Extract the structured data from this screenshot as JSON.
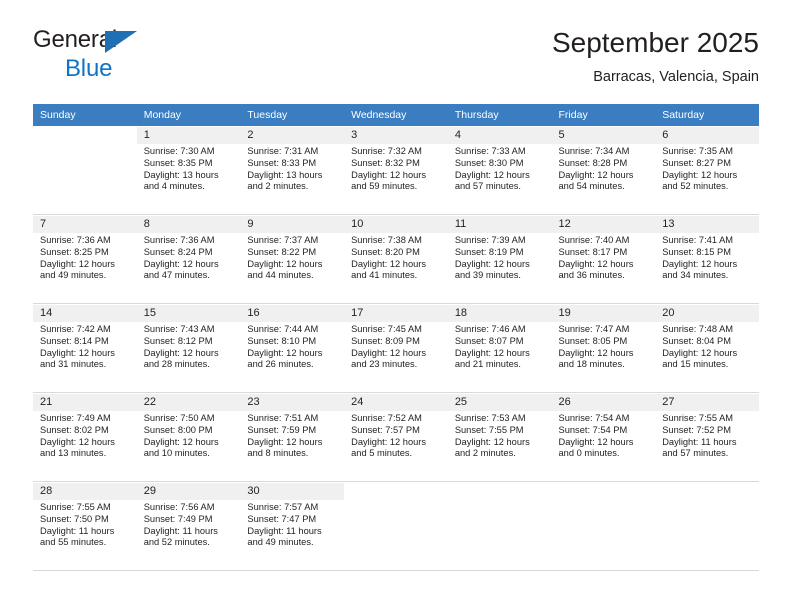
{
  "brand": {
    "name_part1": "General",
    "name_part2": "Blue",
    "triangle_icon": "triangle-icon"
  },
  "header": {
    "title": "September 2025",
    "subtitle": "Barracas, Valencia, Spain"
  },
  "colors": {
    "header_band": "#3a7dc0",
    "brand_blue": "#1273c4",
    "daynum_bg": "#f0f0f0",
    "grid_line": "#d9d9d9",
    "text": "#231f20"
  },
  "weekday_headers": [
    "Sunday",
    "Monday",
    "Tuesday",
    "Wednesday",
    "Thursday",
    "Friday",
    "Saturday"
  ],
  "weeks": [
    [
      {
        "day": "",
        "lines": []
      },
      {
        "day": "1",
        "lines": [
          "Sunrise: 7:30 AM",
          "Sunset: 8:35 PM",
          "Daylight: 13 hours",
          "and 4 minutes."
        ]
      },
      {
        "day": "2",
        "lines": [
          "Sunrise: 7:31 AM",
          "Sunset: 8:33 PM",
          "Daylight: 13 hours",
          "and 2 minutes."
        ]
      },
      {
        "day": "3",
        "lines": [
          "Sunrise: 7:32 AM",
          "Sunset: 8:32 PM",
          "Daylight: 12 hours",
          "and 59 minutes."
        ]
      },
      {
        "day": "4",
        "lines": [
          "Sunrise: 7:33 AM",
          "Sunset: 8:30 PM",
          "Daylight: 12 hours",
          "and 57 minutes."
        ]
      },
      {
        "day": "5",
        "lines": [
          "Sunrise: 7:34 AM",
          "Sunset: 8:28 PM",
          "Daylight: 12 hours",
          "and 54 minutes."
        ]
      },
      {
        "day": "6",
        "lines": [
          "Sunrise: 7:35 AM",
          "Sunset: 8:27 PM",
          "Daylight: 12 hours",
          "and 52 minutes."
        ]
      }
    ],
    [
      {
        "day": "7",
        "lines": [
          "Sunrise: 7:36 AM",
          "Sunset: 8:25 PM",
          "Daylight: 12 hours",
          "and 49 minutes."
        ]
      },
      {
        "day": "8",
        "lines": [
          "Sunrise: 7:36 AM",
          "Sunset: 8:24 PM",
          "Daylight: 12 hours",
          "and 47 minutes."
        ]
      },
      {
        "day": "9",
        "lines": [
          "Sunrise: 7:37 AM",
          "Sunset: 8:22 PM",
          "Daylight: 12 hours",
          "and 44 minutes."
        ]
      },
      {
        "day": "10",
        "lines": [
          "Sunrise: 7:38 AM",
          "Sunset: 8:20 PM",
          "Daylight: 12 hours",
          "and 41 minutes."
        ]
      },
      {
        "day": "11",
        "lines": [
          "Sunrise: 7:39 AM",
          "Sunset: 8:19 PM",
          "Daylight: 12 hours",
          "and 39 minutes."
        ]
      },
      {
        "day": "12",
        "lines": [
          "Sunrise: 7:40 AM",
          "Sunset: 8:17 PM",
          "Daylight: 12 hours",
          "and 36 minutes."
        ]
      },
      {
        "day": "13",
        "lines": [
          "Sunrise: 7:41 AM",
          "Sunset: 8:15 PM",
          "Daylight: 12 hours",
          "and 34 minutes."
        ]
      }
    ],
    [
      {
        "day": "14",
        "lines": [
          "Sunrise: 7:42 AM",
          "Sunset: 8:14 PM",
          "Daylight: 12 hours",
          "and 31 minutes."
        ]
      },
      {
        "day": "15",
        "lines": [
          "Sunrise: 7:43 AM",
          "Sunset: 8:12 PM",
          "Daylight: 12 hours",
          "and 28 minutes."
        ]
      },
      {
        "day": "16",
        "lines": [
          "Sunrise: 7:44 AM",
          "Sunset: 8:10 PM",
          "Daylight: 12 hours",
          "and 26 minutes."
        ]
      },
      {
        "day": "17",
        "lines": [
          "Sunrise: 7:45 AM",
          "Sunset: 8:09 PM",
          "Daylight: 12 hours",
          "and 23 minutes."
        ]
      },
      {
        "day": "18",
        "lines": [
          "Sunrise: 7:46 AM",
          "Sunset: 8:07 PM",
          "Daylight: 12 hours",
          "and 21 minutes."
        ]
      },
      {
        "day": "19",
        "lines": [
          "Sunrise: 7:47 AM",
          "Sunset: 8:05 PM",
          "Daylight: 12 hours",
          "and 18 minutes."
        ]
      },
      {
        "day": "20",
        "lines": [
          "Sunrise: 7:48 AM",
          "Sunset: 8:04 PM",
          "Daylight: 12 hours",
          "and 15 minutes."
        ]
      }
    ],
    [
      {
        "day": "21",
        "lines": [
          "Sunrise: 7:49 AM",
          "Sunset: 8:02 PM",
          "Daylight: 12 hours",
          "and 13 minutes."
        ]
      },
      {
        "day": "22",
        "lines": [
          "Sunrise: 7:50 AM",
          "Sunset: 8:00 PM",
          "Daylight: 12 hours",
          "and 10 minutes."
        ]
      },
      {
        "day": "23",
        "lines": [
          "Sunrise: 7:51 AM",
          "Sunset: 7:59 PM",
          "Daylight: 12 hours",
          "and 8 minutes."
        ]
      },
      {
        "day": "24",
        "lines": [
          "Sunrise: 7:52 AM",
          "Sunset: 7:57 PM",
          "Daylight: 12 hours",
          "and 5 minutes."
        ]
      },
      {
        "day": "25",
        "lines": [
          "Sunrise: 7:53 AM",
          "Sunset: 7:55 PM",
          "Daylight: 12 hours",
          "and 2 minutes."
        ]
      },
      {
        "day": "26",
        "lines": [
          "Sunrise: 7:54 AM",
          "Sunset: 7:54 PM",
          "Daylight: 12 hours",
          "and 0 minutes."
        ]
      },
      {
        "day": "27",
        "lines": [
          "Sunrise: 7:55 AM",
          "Sunset: 7:52 PM",
          "Daylight: 11 hours",
          "and 57 minutes."
        ]
      }
    ],
    [
      {
        "day": "28",
        "lines": [
          "Sunrise: 7:55 AM",
          "Sunset: 7:50 PM",
          "Daylight: 11 hours",
          "and 55 minutes."
        ]
      },
      {
        "day": "29",
        "lines": [
          "Sunrise: 7:56 AM",
          "Sunset: 7:49 PM",
          "Daylight: 11 hours",
          "and 52 minutes."
        ]
      },
      {
        "day": "30",
        "lines": [
          "Sunrise: 7:57 AM",
          "Sunset: 7:47 PM",
          "Daylight: 11 hours",
          "and 49 minutes."
        ]
      },
      {
        "day": "",
        "lines": []
      },
      {
        "day": "",
        "lines": []
      },
      {
        "day": "",
        "lines": []
      },
      {
        "day": "",
        "lines": []
      }
    ]
  ]
}
